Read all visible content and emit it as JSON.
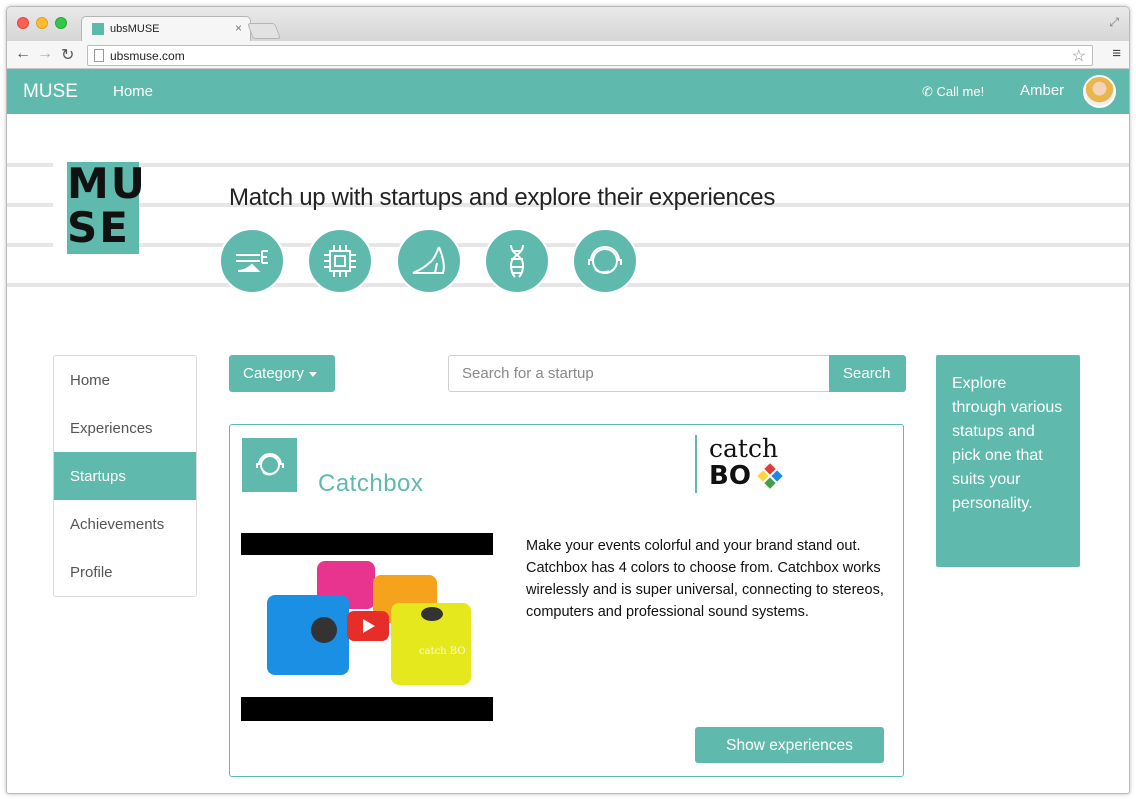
{
  "browser": {
    "tab_title": "ubsMUSE",
    "tab_close": "×",
    "url": "ubsmuse.com",
    "back_glyph": "←",
    "forward_glyph": "→",
    "reload_glyph": "↻",
    "star_glyph": "☆",
    "menu_glyph": "≡",
    "resize_glyph": "⤢"
  },
  "navbar": {
    "brand": "MUSE",
    "home_label": "Home",
    "call_label": "✆ Call me!",
    "user_name": "Amber"
  },
  "hero": {
    "logo_line1": "MU",
    "logo_line2": "SE",
    "tagline": "Match up with startups and explore their experiences",
    "category_icons": [
      "fintech-icon",
      "chip-icon",
      "high-heel-icon",
      "dna-icon",
      "headset-icon"
    ]
  },
  "sidebar": {
    "items": [
      {
        "label": "Home"
      },
      {
        "label": "Experiences"
      },
      {
        "label": "Startups"
      },
      {
        "label": "Achievements"
      },
      {
        "label": "Profile"
      }
    ],
    "active_index": 2
  },
  "toolbar": {
    "category_label": "Category",
    "search_placeholder": "Search for a startup",
    "search_button": "Search"
  },
  "info_box": {
    "text": "Explore through various statups and pick one that suits your personality."
  },
  "card": {
    "title": "Catchbox",
    "logo_top": "catch",
    "logo_bottom": "BO",
    "description": "Make your events colorful and your brand stand out. Catchbox has 4 colors to choose from. Catchbox works wirelessly and is super universal, connecting to stereos, computers and professional sound systems.",
    "cube_label": "catch BO",
    "button_label": "Show experiences"
  },
  "colors": {
    "accent": "#5fbaad",
    "logo_diamond": [
      "#e53935",
      "#1e88e5",
      "#fdd835",
      "#43a047"
    ]
  }
}
